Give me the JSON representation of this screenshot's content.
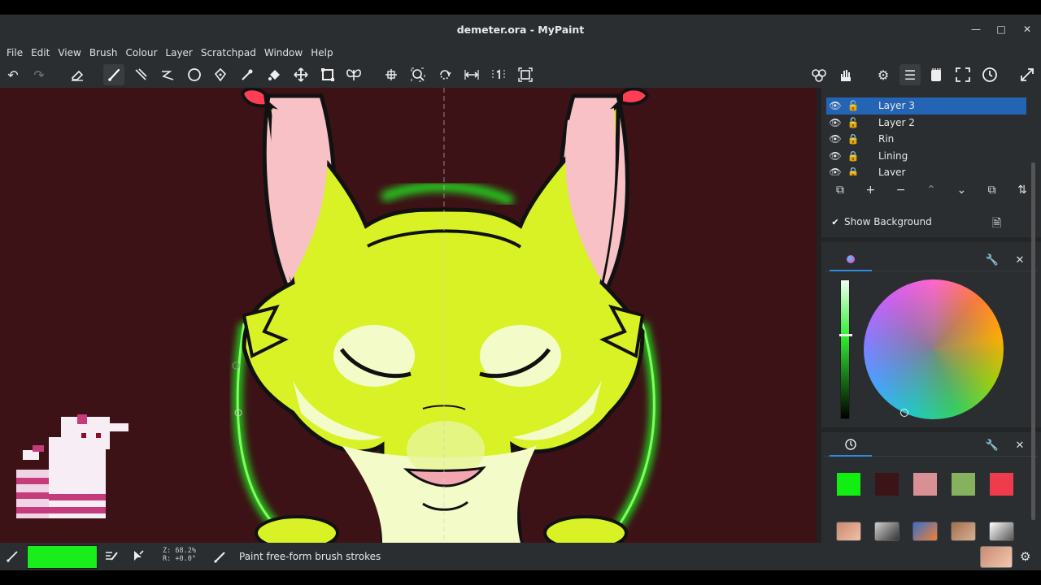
{
  "window": {
    "title": "demeter.ora - MyPaint"
  },
  "menu": [
    "File",
    "Edit",
    "View",
    "Brush",
    "Colour",
    "Layer",
    "Scratchpad",
    "Window",
    "Help"
  ],
  "layers": {
    "items": [
      {
        "name": "Layer 3",
        "visible": true,
        "locked": false,
        "selected": true
      },
      {
        "name": "Layer 2",
        "visible": true,
        "locked": false,
        "selected": false
      },
      {
        "name": "Rin",
        "visible": true,
        "locked": true,
        "selected": false
      },
      {
        "name": "Lining",
        "visible": true,
        "locked": true,
        "selected": false
      },
      {
        "name": "Layer",
        "visible": true,
        "locked": true,
        "selected": false
      }
    ],
    "show_background_label": "Show Background",
    "show_background_checked": true
  },
  "colors": {
    "current": "#1aee1a",
    "recent": [
      "#11ee11",
      "#3b1418",
      "#d99095",
      "#86b25e",
      "#ef3b4b"
    ],
    "canvas_bg": "#3c1216",
    "accent": "#2464b4"
  },
  "status": {
    "zoom": "Z: 68.2%",
    "rotation": "R: +0.0°",
    "message": "Paint free-form brush strokes"
  }
}
